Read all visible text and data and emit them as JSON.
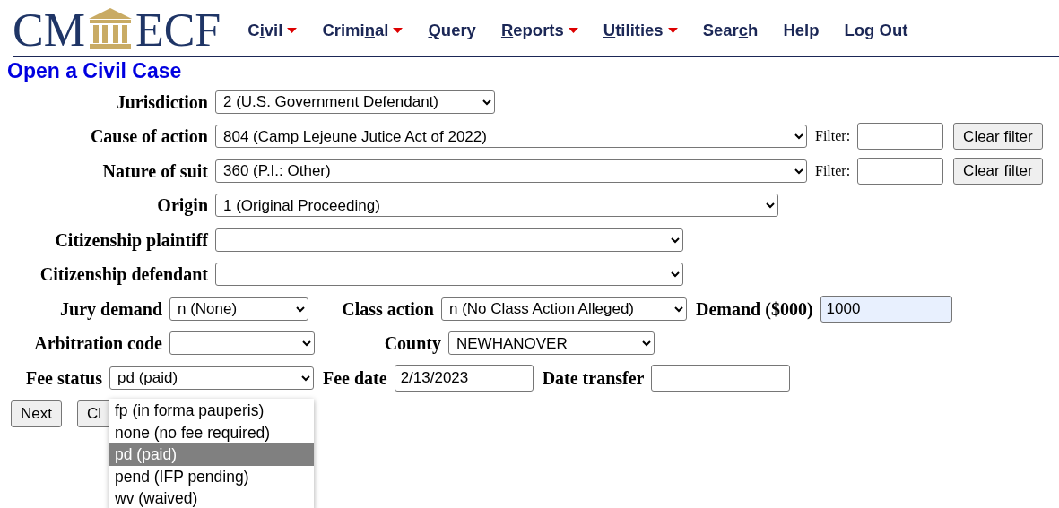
{
  "logo": {
    "left": "CM",
    "right": "ECF"
  },
  "menu": [
    {
      "pre": "C",
      "key": "i",
      "post": "vil",
      "dropdown": true
    },
    {
      "pre": "Crimi",
      "key": "n",
      "post": "al",
      "dropdown": true
    },
    {
      "key": "Q",
      "post": "uery",
      "dropdown": false
    },
    {
      "key": "R",
      "post": "eports",
      "dropdown": true
    },
    {
      "key": "U",
      "post": "tilities",
      "dropdown": true
    },
    {
      "pre": "Sear",
      "key": "c",
      "post": "h",
      "dropdown": false
    },
    {
      "pre": "Help",
      "dropdown": false
    },
    {
      "pre": "Log Out",
      "dropdown": false
    }
  ],
  "heading": "Open a Civil Case",
  "rows": [
    {
      "items": [
        {
          "kind": "label",
          "text": "Jurisdiction"
        },
        {
          "kind": "select",
          "value": "2 (U.S. Government Defendant)"
        }
      ]
    },
    {
      "items": [
        {
          "kind": "label",
          "text": "Cause of action"
        },
        {
          "kind": "select",
          "value": "804 (Camp Lejeune Jutice Act of 2022)"
        },
        {
          "kind": "small_label",
          "text": "Filter:"
        },
        {
          "kind": "input",
          "value": "",
          "autofilled": false
        },
        {
          "kind": "button",
          "text": "Clear filter"
        }
      ]
    },
    {
      "items": [
        {
          "kind": "label",
          "text": "Nature of suit"
        },
        {
          "kind": "select",
          "value": "360 (P.I.: Other)"
        },
        {
          "kind": "small_label",
          "text": "Filter:"
        },
        {
          "kind": "input",
          "value": "",
          "autofilled": false
        },
        {
          "kind": "button",
          "text": "Clear filter"
        }
      ]
    },
    {
      "items": [
        {
          "kind": "label",
          "text": "Origin"
        },
        {
          "kind": "select",
          "value": "1 (Original Proceeding)"
        }
      ]
    },
    {
      "items": [
        {
          "kind": "label",
          "text": "Citizenship plaintiff"
        },
        {
          "kind": "select",
          "value": ""
        }
      ]
    },
    {
      "items": [
        {
          "kind": "label",
          "text": "Citizenship defendant"
        },
        {
          "kind": "select",
          "value": ""
        }
      ]
    },
    {
      "items": [
        {
          "kind": "label",
          "text": "Jury demand"
        },
        {
          "kind": "select",
          "value": "n (None)"
        },
        {
          "kind": "label",
          "text": "Class action"
        },
        {
          "kind": "select",
          "value": "n (No Class Action Alleged)"
        },
        {
          "kind": "label",
          "text": "Demand ($000)"
        },
        {
          "kind": "input",
          "value": "1000",
          "autofilled": true
        }
      ]
    },
    {
      "items": [
        {
          "kind": "label",
          "text": "Arbitration code"
        },
        {
          "kind": "select",
          "value": ""
        },
        {
          "kind": "label",
          "text": "County"
        },
        {
          "kind": "select",
          "value": "NEWHANOVER"
        }
      ]
    },
    {
      "items": [
        {
          "kind": "label",
          "text": "Fee status"
        },
        {
          "kind": "select",
          "value": "pd (paid)"
        },
        {
          "kind": "label",
          "text": "Fee date"
        },
        {
          "kind": "input",
          "value": "2/13/2023",
          "autofilled": false
        },
        {
          "kind": "label",
          "text": "Date transfer"
        },
        {
          "kind": "input",
          "value": "",
          "autofilled": false
        }
      ]
    }
  ],
  "buttons": [
    {
      "label": "Next"
    },
    {
      "label": "Cl"
    }
  ],
  "open_list": {
    "options": [
      {
        "label": "fp (in forma pauperis)",
        "selected": false
      },
      {
        "label": "none (no fee required)",
        "selected": false
      },
      {
        "label": "pd (paid)",
        "selected": true
      },
      {
        "label": "pend (IFP pending)",
        "selected": false
      },
      {
        "label": "wv (waived)",
        "selected": false
      }
    ]
  }
}
